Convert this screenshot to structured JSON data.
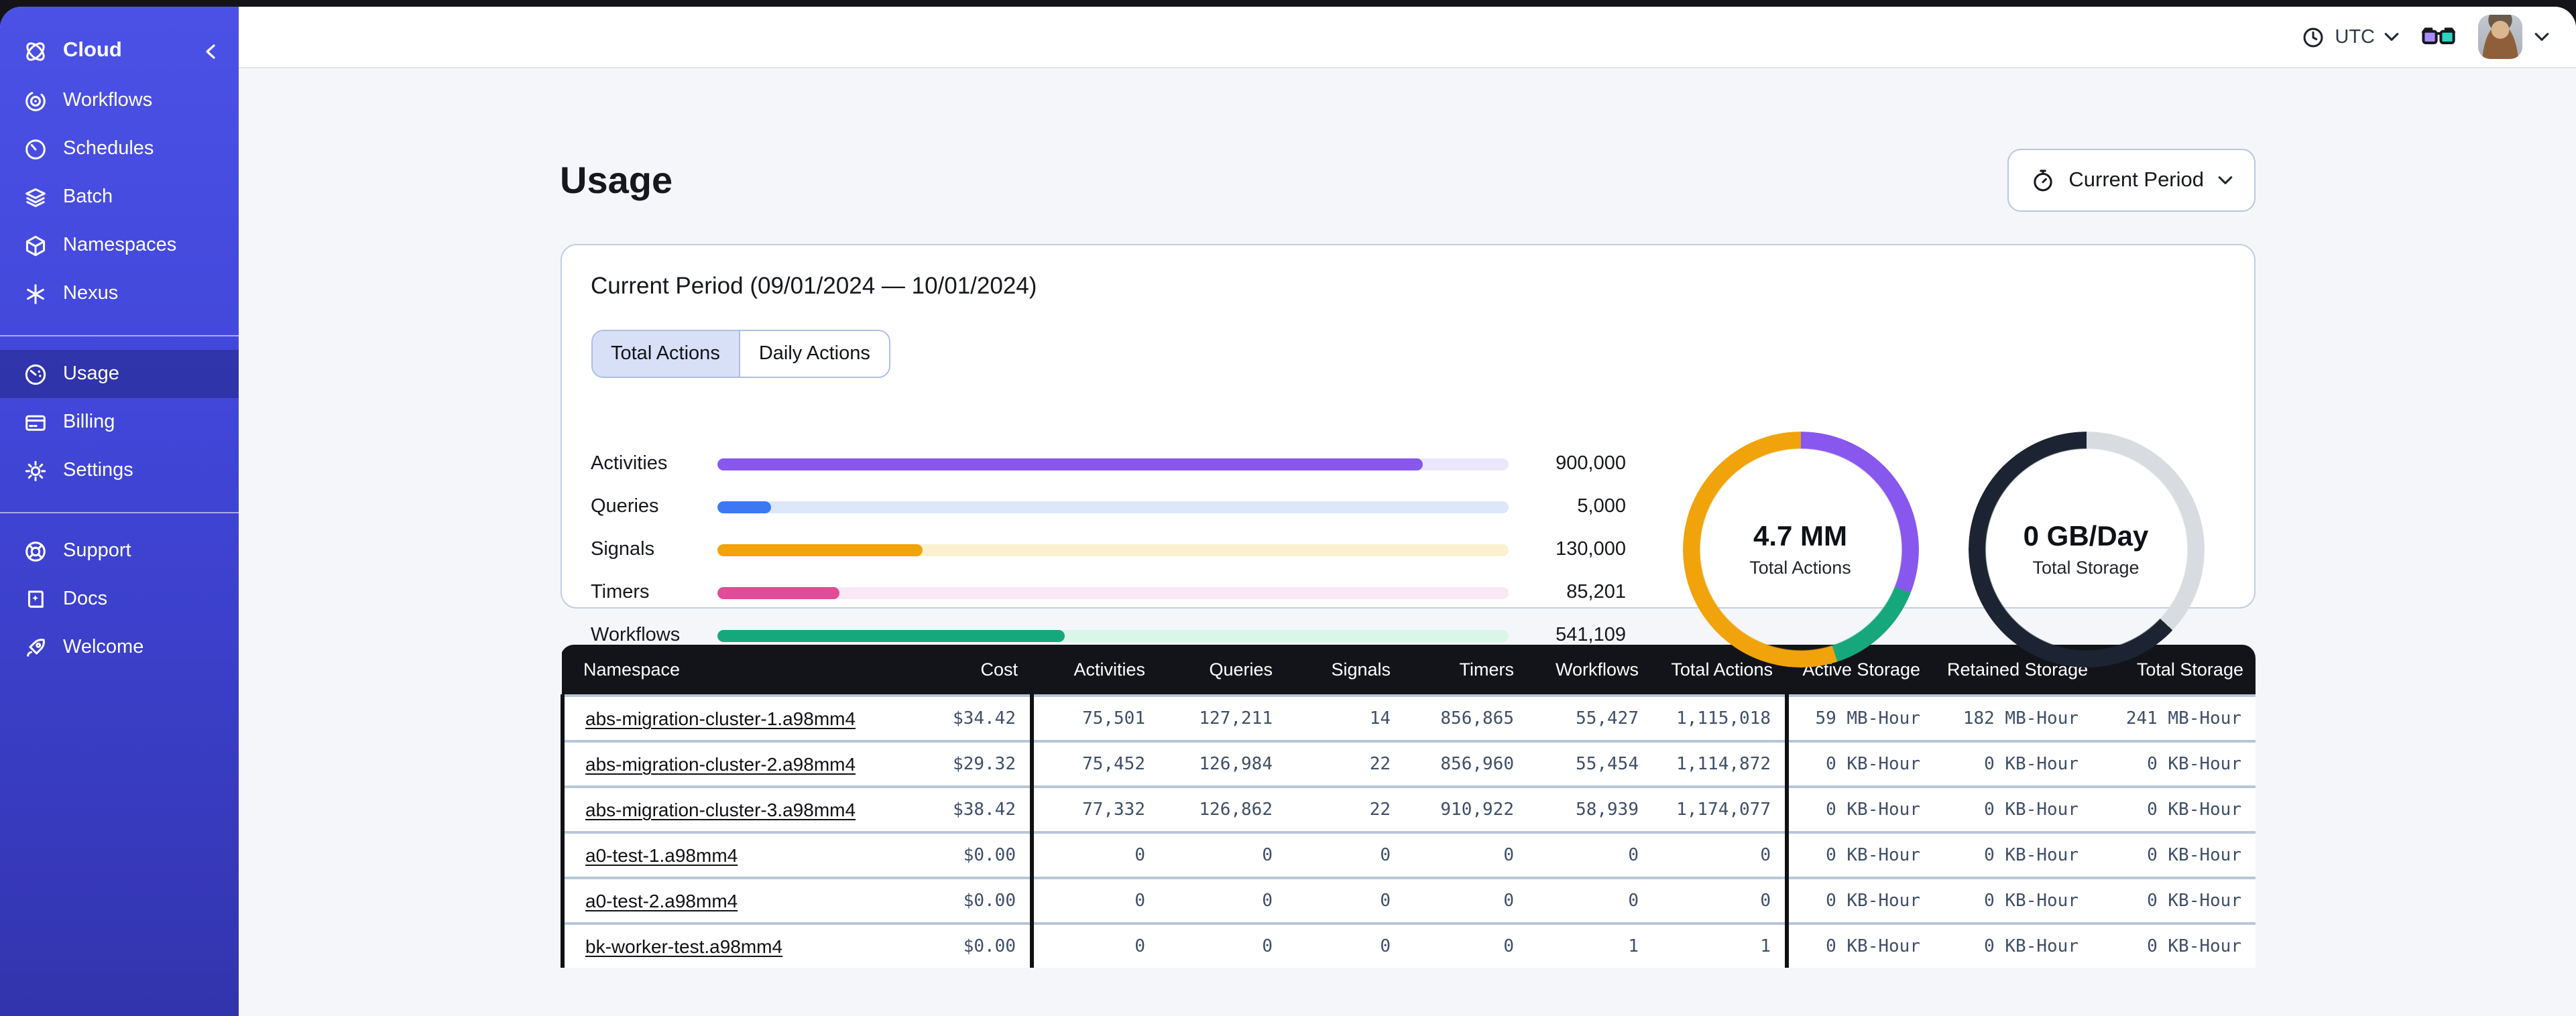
{
  "topbar": {
    "timezone": "UTC"
  },
  "sidebar": {
    "brand": "Cloud",
    "nav_main": [
      {
        "label": "Workflows"
      },
      {
        "label": "Schedules"
      },
      {
        "label": "Batch"
      },
      {
        "label": "Namespaces"
      },
      {
        "label": "Nexus"
      }
    ],
    "nav_account": [
      {
        "label": "Usage",
        "active": true
      },
      {
        "label": "Billing"
      },
      {
        "label": "Settings"
      }
    ],
    "nav_help": [
      {
        "label": "Support"
      },
      {
        "label": "Docs"
      },
      {
        "label": "Welcome"
      }
    ]
  },
  "page": {
    "title": "Usage",
    "period_selector": "Current Period"
  },
  "usage_card": {
    "title": "Current Period (09/01/2024 — 10/01/2024)",
    "tabs": [
      {
        "label": "Total Actions",
        "active": true
      },
      {
        "label": "Daily Actions",
        "active": false
      }
    ]
  },
  "chart_data": [
    {
      "type": "bar",
      "orientation": "horizontal",
      "categories": [
        "Activities",
        "Queries",
        "Signals",
        "Timers",
        "Workflows"
      ],
      "values": [
        900000,
        5000,
        130000,
        85201,
        541109
      ],
      "bars": [
        {
          "label": "Activities",
          "value_display": "900,000",
          "fill_pct": "89.3%",
          "color": "#8757EE",
          "track_color": "#ECE6FC"
        },
        {
          "label": "Queries",
          "value_display": "5,000",
          "fill_pct": "6.9%",
          "color": "#3D78F2",
          "track_color": "#DCE7FB"
        },
        {
          "label": "Signals",
          "value_display": "130,000",
          "fill_pct": "26%",
          "color": "#F0A30B",
          "track_color": "#FBF1CE"
        },
        {
          "label": "Timers",
          "value_display": "85,201",
          "fill_pct": "15.5%",
          "color": "#E24B96",
          "track_color": "#FBE8F6"
        },
        {
          "label": "Workflows",
          "value_display": "541,109",
          "fill_pct": "44%",
          "color": "#17A77C",
          "track_color": "#D9F6E8"
        }
      ]
    },
    {
      "type": "donut",
      "center_value": "4.7 MM",
      "center_label": "Total Actions",
      "segments": [
        {
          "color": "#8757EE",
          "pct": 31
        },
        {
          "color": "#17A77C",
          "pct": 14
        },
        {
          "color": "#F0A30B",
          "pct": 55
        }
      ]
    },
    {
      "type": "donut",
      "center_value": "0 GB/Day",
      "center_label": "Total Storage",
      "segments": [
        {
          "color": "#D8DBE0",
          "pct": 37
        },
        {
          "color": "#1C2433",
          "pct": 63
        }
      ]
    }
  ],
  "table": {
    "columns": [
      "Namespace",
      "Cost",
      "Activities",
      "Queries",
      "Signals",
      "Timers",
      "Workflows",
      "Total Actions",
      "Active Storage",
      "Retained Storage",
      "Total Storage"
    ],
    "rows": [
      [
        "abs-migration-cluster-1.a98mm4",
        "$34.42",
        "75,501",
        "127,211",
        "14",
        "856,865",
        "55,427",
        "1,115,018",
        "59 MB-Hour",
        "182 MB-Hour",
        "241 MB-Hour"
      ],
      [
        "abs-migration-cluster-2.a98mm4",
        "$29.32",
        "75,452",
        "126,984",
        "22",
        "856,960",
        "55,454",
        "1,114,872",
        "0 KB-Hour",
        "0 KB-Hour",
        "0 KB-Hour"
      ],
      [
        "abs-migration-cluster-3.a98mm4",
        "$38.42",
        "77,332",
        "126,862",
        "22",
        "910,922",
        "58,939",
        "1,174,077",
        "0 KB-Hour",
        "0 KB-Hour",
        "0 KB-Hour"
      ],
      [
        "a0-test-1.a98mm4",
        "$0.00",
        "0",
        "0",
        "0",
        "0",
        "0",
        "0",
        "0 KB-Hour",
        "0 KB-Hour",
        "0 KB-Hour"
      ],
      [
        "a0-test-2.a98mm4",
        "$0.00",
        "0",
        "0",
        "0",
        "0",
        "0",
        "0",
        "0 KB-Hour",
        "0 KB-Hour",
        "0 KB-Hour"
      ],
      [
        "bk-worker-test.a98mm4",
        "$0.00",
        "0",
        "0",
        "0",
        "0",
        "1",
        "1",
        "0 KB-Hour",
        "0 KB-Hour",
        "0 KB-Hour"
      ]
    ]
  },
  "colors": {
    "sidebar_top": "#4C51E6",
    "sidebar_bottom": "#3234AD",
    "table_header_bg": "#131419",
    "glasses_left_lens": "#A78BFA",
    "glasses_right_lens": "#2DD4BF"
  }
}
